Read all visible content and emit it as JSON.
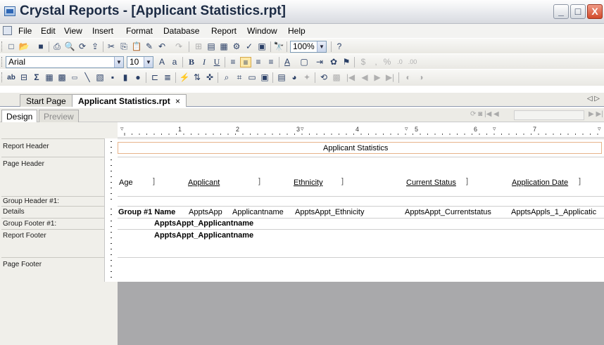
{
  "titlebar": {
    "title": "Crystal Reports - [Applicant Statistics.rpt]",
    "minimize": "_",
    "maximize": "□",
    "close": "X"
  },
  "menu": [
    "File",
    "Edit",
    "View",
    "Insert",
    "Format",
    "Database",
    "Report",
    "Window",
    "Help"
  ],
  "toolbar": {
    "zoom_value": "100%",
    "font_name": "Arial",
    "font_size": "10",
    "bold": "B",
    "italic": "I",
    "underline": "U",
    "currency": "$",
    "comma": ",",
    "percent": "%"
  },
  "tabs": {
    "start_page": "Start Page",
    "document": "Applicant Statistics.rpt",
    "close": "×",
    "scroll": "◁ ▷"
  },
  "view_tabs": {
    "design": "Design",
    "preview": "Preview"
  },
  "ruler": [
    "1",
    "2",
    "3",
    "4",
    "5",
    "6",
    "7"
  ],
  "sections": {
    "report_header": "Report Header",
    "page_header": "Page Header",
    "group_header": "Group Header #1:",
    "details": "Details",
    "group_footer": "Group Footer #1:",
    "report_footer": "Report Footer",
    "page_footer": "Page Footer"
  },
  "report": {
    "title": "Applicant Statistics",
    "columns": [
      "Age",
      "Applicant",
      "Ethnicity",
      "Current Status",
      "Application Date"
    ],
    "details": [
      "Group #1 Name",
      "ApptsApp",
      "Applicantname",
      "ApptsAppt_Ethnicity",
      "ApptsAppt_Currentstatus",
      "ApptsAppls_1_Applicatic"
    ],
    "group_footer_field": "ApptsAppt_Applicantname",
    "report_footer_field": "ApptsAppt_Applicantname"
  }
}
